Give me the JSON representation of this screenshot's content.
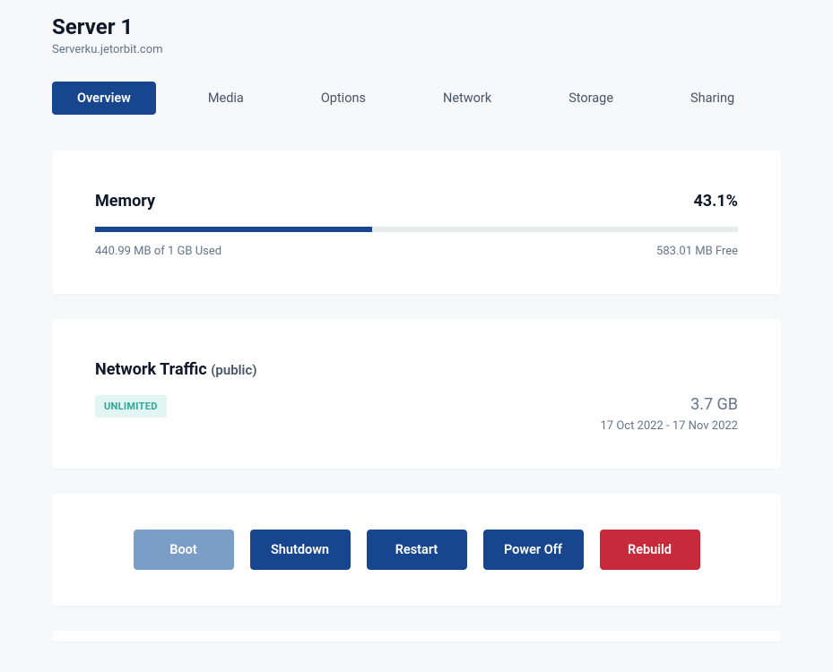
{
  "header": {
    "title": "Server 1",
    "subtitle": "Serverku.jetorbit.com"
  },
  "tabs": [
    {
      "label": "Overview",
      "active": true
    },
    {
      "label": "Media",
      "active": false
    },
    {
      "label": "Options",
      "active": false
    },
    {
      "label": "Network",
      "active": false
    },
    {
      "label": "Storage",
      "active": false
    },
    {
      "label": "Sharing",
      "active": false
    }
  ],
  "memory": {
    "title": "Memory",
    "percent_label": "43.1%",
    "percent_value": 43.1,
    "used_label": "440.99 MB of 1 GB Used",
    "free_label": "583.01 MB Free"
  },
  "network": {
    "title": "Network Traffic",
    "scope": "(public)",
    "badge": "UNLIMITED",
    "amount": "3.7 GB",
    "date_range": "17 Oct 2022 - 17 Nov 2022"
  },
  "actions": {
    "boot": "Boot",
    "shutdown": "Shutdown",
    "restart": "Restart",
    "poweroff": "Power Off",
    "rebuild": "Rebuild"
  }
}
